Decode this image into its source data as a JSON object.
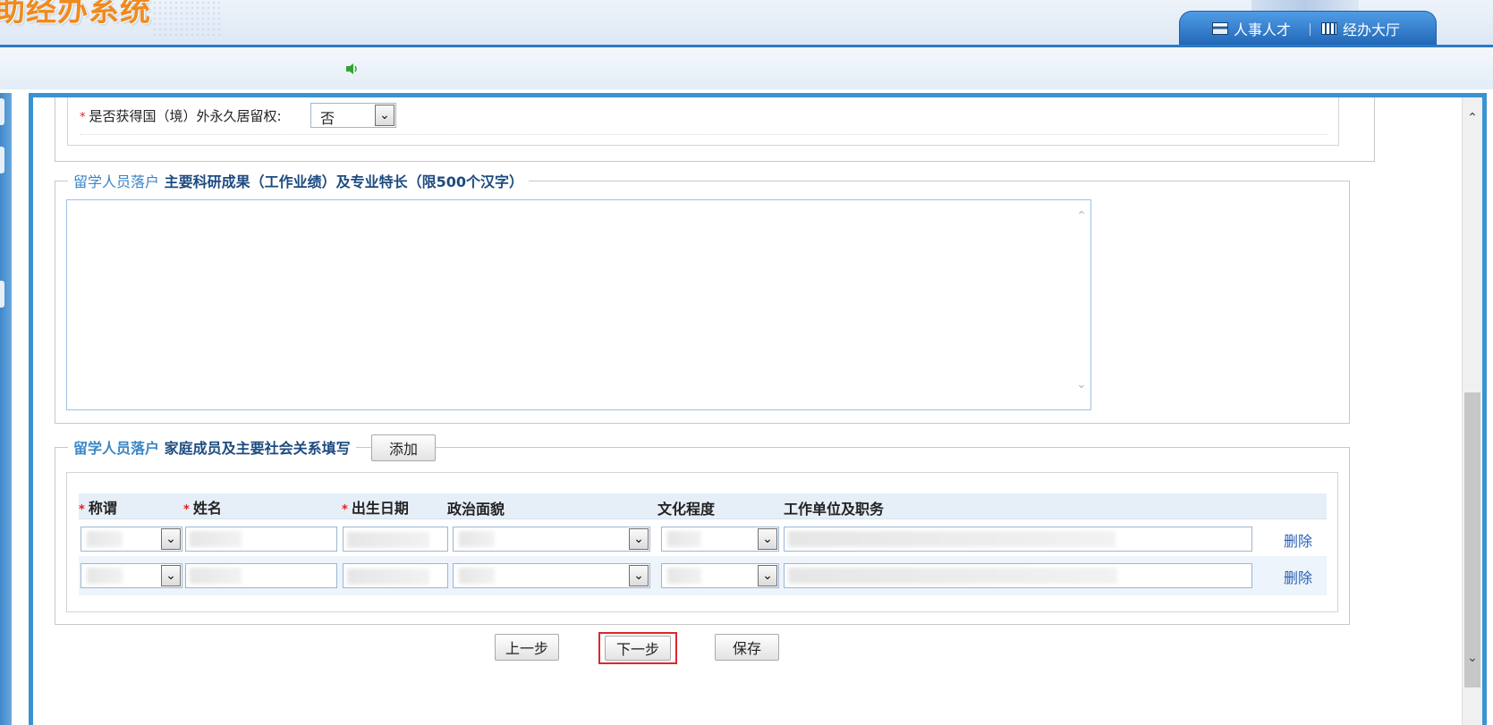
{
  "header": {
    "logo_text": "助经办系统",
    "nav": [
      {
        "label": "人事人才",
        "icon": "book-icon"
      },
      {
        "label": "经办大厅",
        "icon": "hall-icon"
      }
    ]
  },
  "residency_question": {
    "label": "是否获得国（境）外永久居留权:",
    "value": "否"
  },
  "research_section": {
    "legend_prefix": "留学人员落户",
    "legend_text": "主要科研成果（工作业绩）及专业特长（限500个汉字）",
    "textarea_value": ""
  },
  "family_section": {
    "legend_prefix": "留学人员落户",
    "legend_text": "家庭成员及主要社会关系填写",
    "add_label": "添加",
    "columns": [
      "称谓",
      "姓名",
      "出生日期",
      "政治面貌",
      "文化程度",
      "工作单位及职务"
    ],
    "required_columns": [
      true,
      true,
      true,
      false,
      false,
      false
    ],
    "rows": [
      {
        "delete_label": "删除"
      },
      {
        "delete_label": "删除"
      }
    ]
  },
  "footer_buttons": {
    "prev": "上一步",
    "next": "下一步",
    "save": "保存"
  },
  "colors": {
    "frame_border": "#3a93d1",
    "legend_lead": "#3a86c6",
    "legend_dark": "#1d4b80",
    "required_star": "#e02020",
    "highlight_box": "#d9282f",
    "link": "#2a62b5"
  }
}
